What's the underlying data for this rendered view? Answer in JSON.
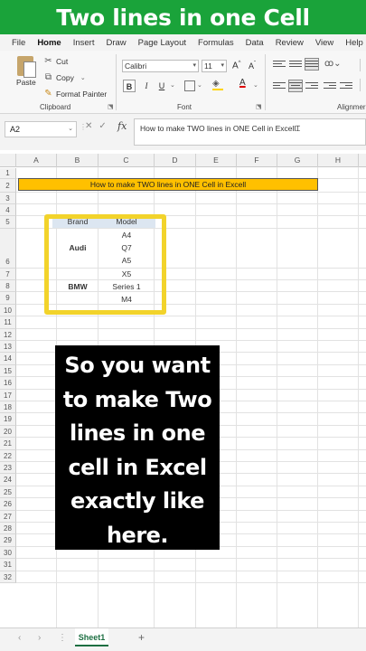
{
  "banner": {
    "title": "Two lines in one Cell"
  },
  "tabs": [
    "File",
    "Home",
    "Insert",
    "Draw",
    "Page Layout",
    "Formulas",
    "Data",
    "Review",
    "View",
    "Help"
  ],
  "clipboard": {
    "paste": "Paste",
    "cut": "Cut",
    "copy": "Copy",
    "format_painter": "Format Painter",
    "group": "Clipboard"
  },
  "font": {
    "name": "Calibri",
    "size": "11",
    "group": "Font",
    "grow": "A",
    "shrink": "A",
    "bold": "B",
    "italic": "I",
    "underline": "U"
  },
  "alignment": {
    "group": "Alignmer"
  },
  "formula_bar": {
    "name_box": "A2",
    "fx": "fx",
    "content": "How to make TWO lines in ONE Cell in Excell"
  },
  "columns": [
    "A",
    "B",
    "C",
    "D",
    "E",
    "F",
    "G",
    "H"
  ],
  "rows": [
    "1",
    "2",
    "3",
    "4",
    "5",
    "6",
    "7",
    "8",
    "9",
    "10",
    "11",
    "12",
    "13",
    "14",
    "15",
    "16",
    "17",
    "18",
    "19",
    "20",
    "21",
    "22",
    "23",
    "24",
    "25",
    "26",
    "27",
    "28",
    "29",
    "30",
    "31",
    "32"
  ],
  "sheet": {
    "title_cell": "How to make TWO lines in ONE Cell in Excell",
    "table_headers": {
      "brand": "Brand",
      "model": "Model"
    },
    "audi": {
      "brand": "Audi",
      "models": [
        "A4",
        "Q7",
        "A5"
      ]
    },
    "bmw": {
      "brand": "BMW",
      "models": [
        "X5",
        "Series 1",
        "M4"
      ]
    }
  },
  "overlay": {
    "lines": [
      "So you want",
      "to make Two",
      "lines in one",
      "cell in Excel",
      "exactly like",
      "here."
    ]
  },
  "sheet_tabs": {
    "active": "Sheet1",
    "add": "+"
  },
  "colors": {
    "banner": "#1aa33a",
    "title_fill": "#ffc000",
    "frame": "#f2d32b",
    "excel_green": "#1d6f42"
  }
}
